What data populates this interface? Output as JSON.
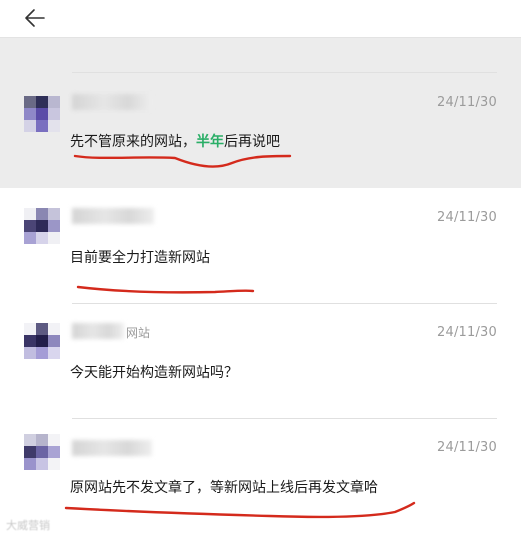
{
  "header": {
    "back_icon": "arrow-left-icon"
  },
  "messages": [
    {
      "time": "24/11/30",
      "text_before": "先不管原来的网站，",
      "text_highlight": "半年",
      "text_after": "后再说吧",
      "highlight_color": "#2aae67",
      "selected": true
    },
    {
      "time": "24/11/30",
      "text": "目前要全力打造新网站"
    },
    {
      "time": "24/11/30",
      "name_tail": "网站",
      "text": "今天能开始构造新网站吗？"
    },
    {
      "time": "24/11/30",
      "text": "原网站先不发文章了，等新网站上线后再发文章哈"
    }
  ],
  "annotation_color": "#d42a1c",
  "watermark": "大威营销"
}
